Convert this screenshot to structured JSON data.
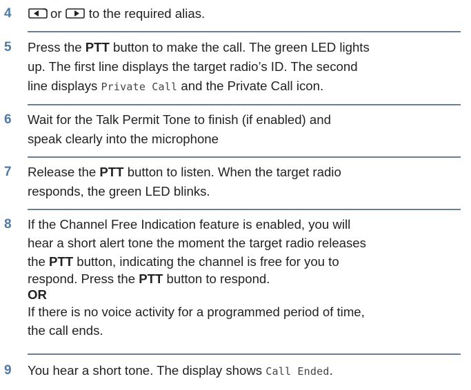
{
  "steps": [
    {
      "number": "4",
      "or_word": "or",
      "text_after_keys": "to the required alias.",
      "left_key_icon": "left-arrow-key-icon",
      "right_key_icon": "right-arrow-key-icon"
    },
    {
      "number": "5",
      "line1_pre": "Press the ",
      "line1_bold": "PTT",
      "line1_post": " button to make the call. The green LED lights",
      "line2": "up. The first line displays the target radio’s ID. The second",
      "line3_pre": "line displays ",
      "line3_mono": "Private Call",
      "line3_post": " and the Private Call icon."
    },
    {
      "number": "6",
      "line1": "Wait for the Talk Permit Tone to finish (if enabled) and",
      "line2": "speak clearly into the microphone"
    },
    {
      "number": "7",
      "line1_pre": "Release the ",
      "line1_bold": "PTT",
      "line1_post": " button to listen. When the target radio",
      "line2": "responds, the green LED blinks."
    },
    {
      "number": "8",
      "line1": "If the Channel Free Indication feature is enabled, you will",
      "line2": "hear a short alert tone the moment the target radio releases",
      "line3_pre": "the ",
      "line3_bold": "PTT",
      "line3_post": " button, indicating the channel is free for you to",
      "line4_pre": "respond. Press the ",
      "line4_bold": "PTT",
      "line4_post": " button to respond.",
      "or_label": "OR",
      "line5": "If there is no voice activity for a programmed period of time,",
      "line6": "the call ends."
    },
    {
      "number": "9",
      "line1_pre": "You hear a short tone. The display shows ",
      "line1_mono": "Call Ended",
      "line1_post": "."
    }
  ],
  "colors": {
    "step_number": "#4d7aa6",
    "divider": "#6a7f95",
    "text": "#222222"
  }
}
